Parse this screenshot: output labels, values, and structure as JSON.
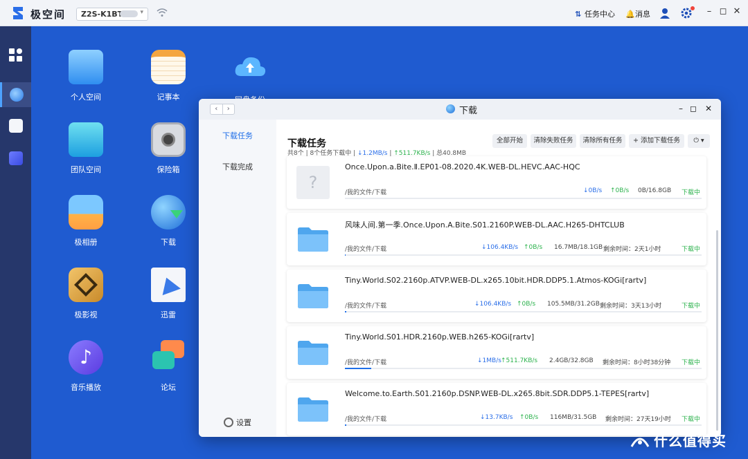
{
  "topbar": {
    "app_title": "极空间",
    "device": "Z2S-K1BT-",
    "task_center": "任务中心",
    "messages": "消息"
  },
  "dock": [
    "apps-icon",
    "browser-icon",
    "xunlei-icon",
    "chart-icon"
  ],
  "desktop": [
    {
      "label": "个人空间",
      "icon": "folder-icon"
    },
    {
      "label": "记事本",
      "icon": "notepad-icon"
    },
    {
      "label": "网盘备份",
      "icon": "cloud-upload-icon"
    },
    {
      "label": "团队空间",
      "icon": "team-folder-icon"
    },
    {
      "label": "保险箱",
      "icon": "safe-icon"
    },
    {
      "label": "极相册",
      "icon": "photos-icon"
    },
    {
      "label": "下载",
      "icon": "download-icon"
    },
    {
      "label": "极影视",
      "icon": "video-icon"
    },
    {
      "label": "迅雷",
      "icon": "xunlei-icon"
    },
    {
      "label": "音乐播放",
      "icon": "music-icon"
    },
    {
      "label": "论坛",
      "icon": "forum-icon"
    }
  ],
  "window": {
    "title": "下载",
    "sidebar": {
      "downloading": "下载任务",
      "completed": "下载完成",
      "settings": "设置"
    },
    "heading": "下载任务",
    "summary": {
      "count": "共8个 | 8个任务下载中 | ",
      "down": "↓1.2MB/s",
      "sep1": " | ",
      "up": "↑511.7KB/s",
      "total": " | 总40.8MB"
    },
    "actions": {
      "start_all": "全部开始",
      "clear_failed": "清除失败任务",
      "clear_all": "清除所有任务",
      "add_task": "+ 添加下载任务",
      "more": "⏻ ▾"
    },
    "tasks": [
      {
        "name": "Once.Upon.a.Bite.Ⅱ.EP01-08.2020.4K.WEB-DL.HEVC.AAC-HQC",
        "path": "/我的文件/下载",
        "down": "↓0B/s",
        "up": "↑0B/s",
        "size": "0B/16.8GB",
        "remaining": "",
        "status": "下载中",
        "progress": 0,
        "thumb": "unknown-file-icon"
      },
      {
        "name": "风味人间.第一季.Once.Upon.A.Bite.S01.2160P.WEB-DL.AAC.H265-DHTCLUB",
        "path": "/我的文件/下载",
        "down": "↓106.4KB/s",
        "up": "↑0B/s",
        "size": "16.7MB/18.1GB",
        "remaining": "剩余时间：2天1小时",
        "status": "下载中",
        "progress": 0.001,
        "thumb": "folder-icon"
      },
      {
        "name": "Tiny.World.S02.2160p.ATVP.WEB-DL.x265.10bit.HDR.DDP5.1.Atmos-KOGi[rartv]",
        "path": "/我的文件/下载",
        "down": "↓106.4KB/s",
        "up": "↑0B/s",
        "size": "105.5MB/31.2GB",
        "remaining": "剩余时间：3天13小时",
        "status": "下载中",
        "progress": 0.003,
        "thumb": "folder-icon"
      },
      {
        "name": "Tiny.World.S01.HDR.2160p.WEB.h265-KOGi[rartv]",
        "path": "/我的文件/下载",
        "down": "↓1MB/s",
        "up": "↑511.7KB/s",
        "size": "2.4GB/32.8GB",
        "remaining": "剩余时间：8小时38分钟",
        "status": "下载中",
        "progress": 0.073,
        "thumb": "folder-icon"
      },
      {
        "name": "Welcome.to.Earth.S01.2160p.DSNP.WEB-DL.x265.8bit.SDR.DDP5.1-TEPES[rartv]",
        "path": "/我的文件/下载",
        "down": "↓13.7KB/s",
        "up": "↑0B/s",
        "size": "116MB/31.5GB",
        "remaining": "剩余时间：27天19小时",
        "status": "下载中",
        "progress": 0.004,
        "thumb": "folder-icon"
      }
    ]
  },
  "watermark": "什么值得买",
  "colors": {
    "accent": "#1e6ee8",
    "desktop": "#1f5bd0",
    "dock": "#26376b",
    "ok": "#2bb24c"
  }
}
